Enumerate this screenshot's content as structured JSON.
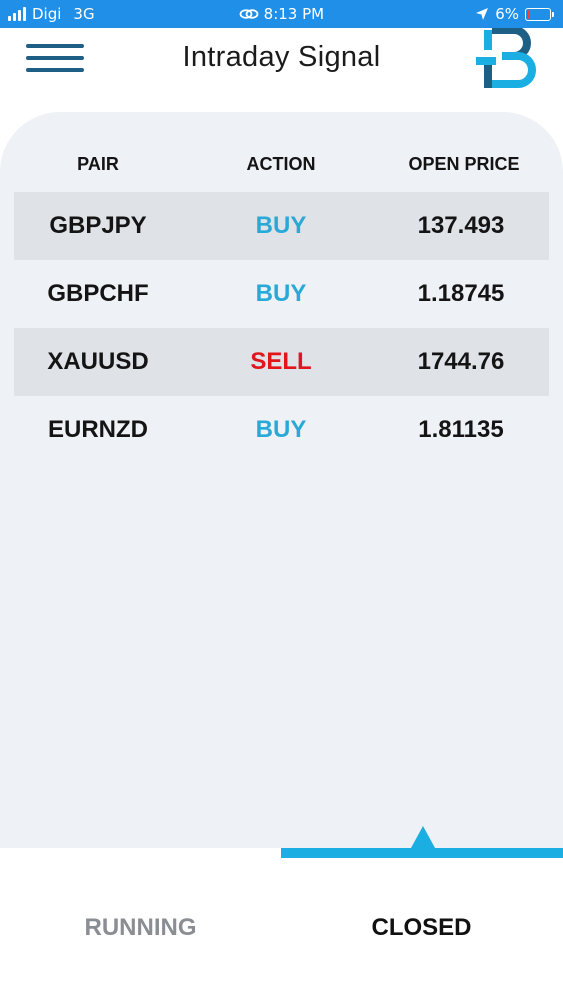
{
  "status_bar": {
    "carrier": "Digi",
    "network": "3G",
    "time": "8:13 PM",
    "battery": "6%"
  },
  "header": {
    "title": "Intraday Signal"
  },
  "table": {
    "columns": [
      "PAIR",
      "ACTION",
      "OPEN PRICE"
    ],
    "rows": [
      {
        "pair": "GBPJPY",
        "action": "BUY",
        "price": "137.493"
      },
      {
        "pair": "GBPCHF",
        "action": "BUY",
        "price": "1.18745"
      },
      {
        "pair": "XAUUSD",
        "action": "SELL",
        "price": "1744.76"
      },
      {
        "pair": "EURNZD",
        "action": "BUY",
        "price": "1.81135"
      }
    ]
  },
  "tabs": {
    "running": "RUNNING",
    "closed": "CLOSED",
    "active": "closed"
  },
  "colors": {
    "status_bar": "#1f8fe8",
    "buy": "#2aa9d8",
    "sell": "#e0161c",
    "accent": "#1aaee2",
    "menu": "#1e5f86"
  }
}
